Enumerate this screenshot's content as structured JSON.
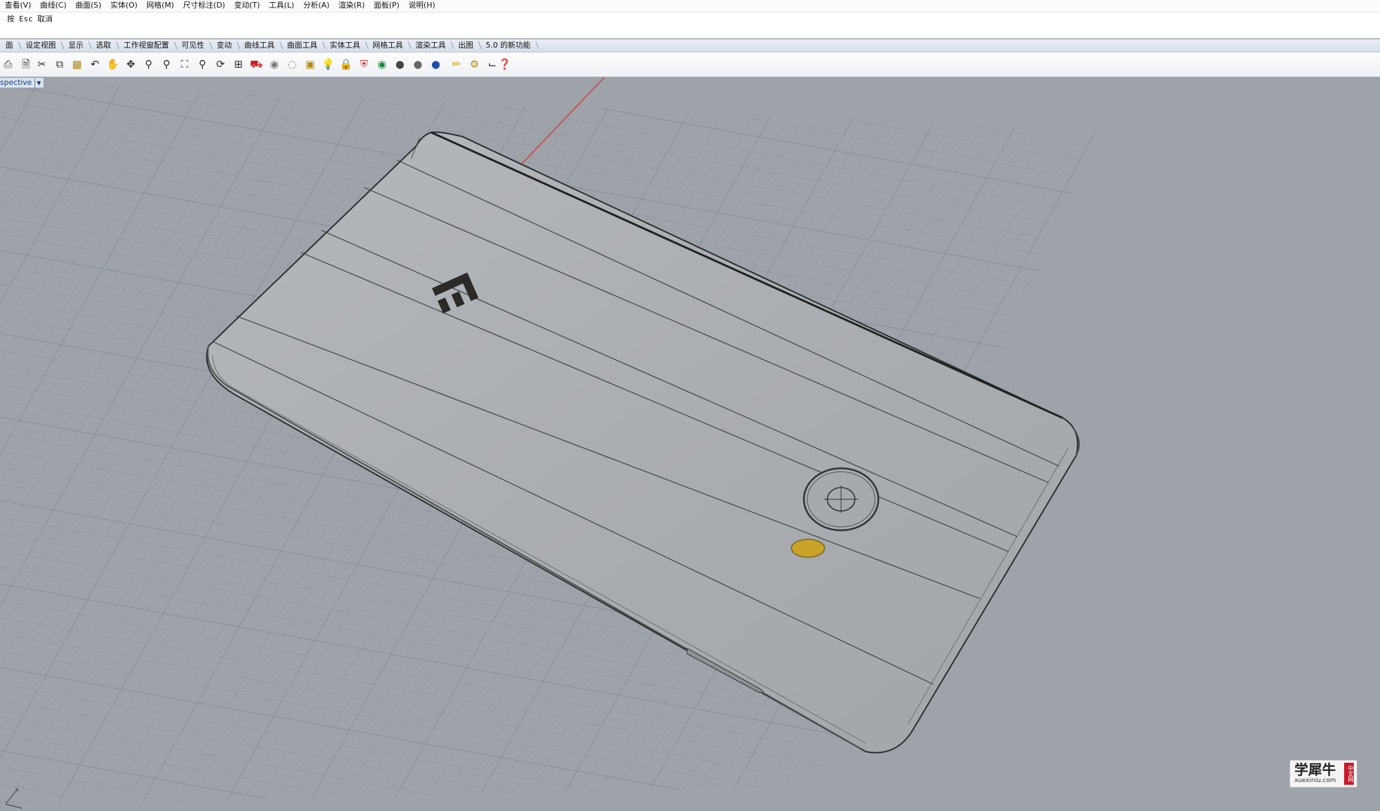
{
  "menubar": {
    "items": [
      "查看(V)",
      "曲线(C)",
      "曲面(S)",
      "实体(O)",
      "网格(M)",
      "尺寸标注(D)",
      "变动(T)",
      "工具(L)",
      "分析(A)",
      "渲染(R)",
      "面板(P)",
      "说明(H)"
    ]
  },
  "command": {
    "prompt": "按 Esc 取消"
  },
  "tabs": [
    "面",
    "设定视图",
    "显示",
    "选取",
    "工作视窗配置",
    "可见性",
    "变动",
    "曲线工具",
    "曲面工具",
    "实体工具",
    "网格工具",
    "渲染工具",
    "出图",
    "5.0 的新功能"
  ],
  "toolbar": {
    "icons": [
      "printer-icon",
      "new-file-icon",
      "cut-icon",
      "copy-icon",
      "paste-icon",
      "undo-icon",
      "pan-hand-icon",
      "move-icon",
      "zoom-icon",
      "zoom-window-icon",
      "zoom-extents-icon",
      "zoom-selected-icon",
      "rotate-view-icon",
      "four-viewports-icon",
      "car-icon",
      "hide-icon",
      "show-icon",
      "layer-icon",
      "light-bulb-icon",
      "lock-icon",
      "shield-icon",
      "color-wheel-icon",
      "render-sphere-icon",
      "material-sphere-icon",
      "environment-sphere-icon",
      "pencil-icon",
      "gears-icon",
      "dimension-icon",
      "help-icon"
    ]
  },
  "viewport": {
    "label": "spective"
  },
  "watermark": {
    "text": "学犀牛",
    "domain": "xuexiniu.com",
    "badge": "中文网"
  },
  "colors": {
    "viewport_bg": "#9ea3aa",
    "grid_line": "#8d939b",
    "phone_body": "#a9adb1",
    "fingerprint_sensor": "#c9a227",
    "x_axis": "#d23c3c",
    "label_text": "#0e3f86"
  }
}
